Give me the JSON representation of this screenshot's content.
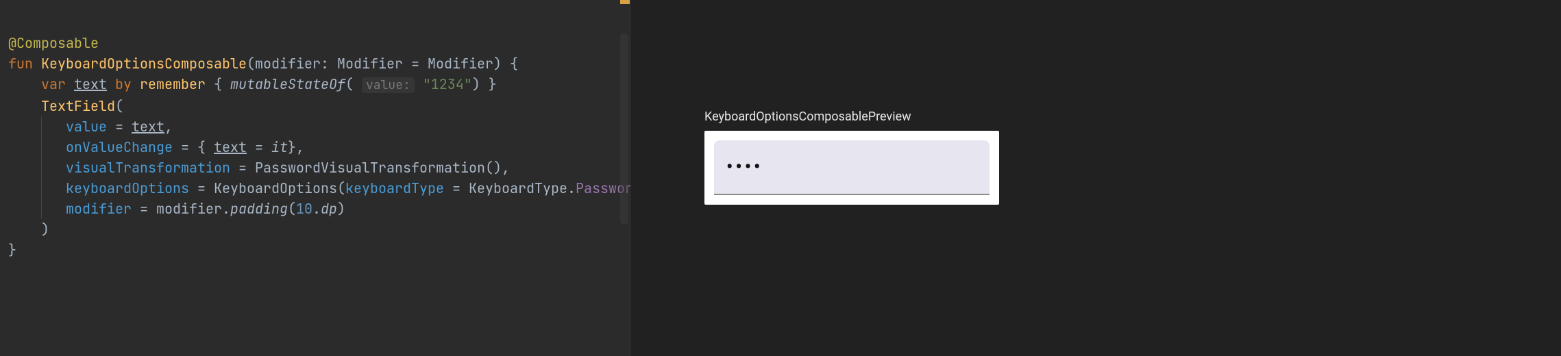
{
  "code": {
    "annotation": "@Composable",
    "kw_fun": "fun",
    "fn_name": "KeyboardOptionsComposable",
    "param_modifier": "modifier",
    "type_modifier": "Modifier",
    "eq": " = ",
    "default_modifier": "Modifier",
    "kw_var": "var",
    "var_text": "text",
    "kw_by": "by",
    "remember": "remember",
    "mstate": "mutableStateOf",
    "hint_value": "value:",
    "str_1234": "\"1234\"",
    "textfield": "TextField",
    "p_value": "value",
    "p_onchange": "onValueChange",
    "it": "it",
    "p_vistrans": "visualTransformation",
    "pwd_vt": "PasswordVisualTransformation",
    "p_kbopts": "keyboardOptions",
    "kbopts": "KeyboardOptions",
    "p_kbtype": "keyboardType",
    "kbtype_type": "KeyboardType",
    "kbtype_val": "Password",
    "p_modifier": "modifier",
    "padding": "padding",
    "num_10": "10",
    "dp": "dp"
  },
  "preview": {
    "title": "KeyboardOptionsComposablePreview",
    "masked": "••••"
  }
}
